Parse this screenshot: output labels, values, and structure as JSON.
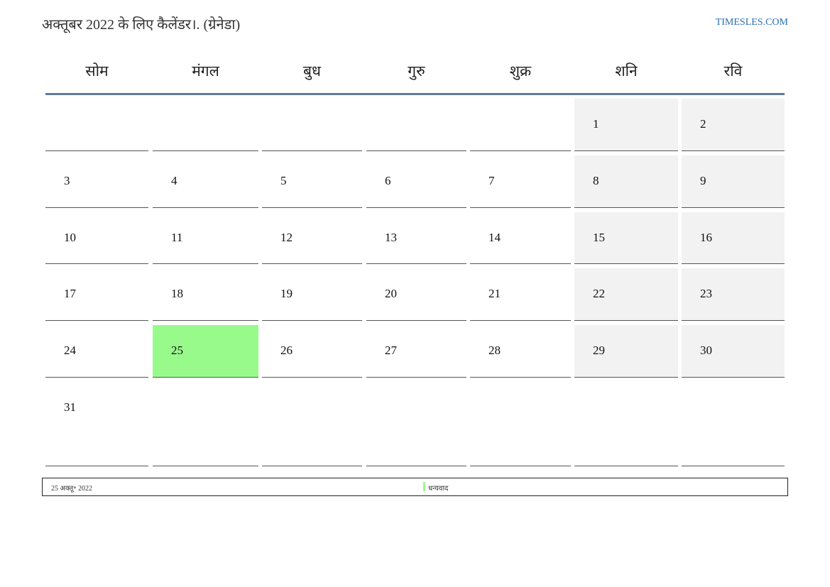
{
  "header": {
    "title": "अक्तूबर 2022 के लिए कैलेंडर।. (ग्रेनेडा)",
    "site_link": "TIMESLES.COM"
  },
  "weekdays": [
    "सोम",
    "मंगल",
    "बुध",
    "गुरु",
    "शुक्र",
    "शनि",
    "रवि"
  ],
  "weeks": [
    [
      "",
      "",
      "",
      "",
      "",
      "1",
      "2"
    ],
    [
      "3",
      "4",
      "5",
      "6",
      "7",
      "8",
      "9"
    ],
    [
      "10",
      "11",
      "12",
      "13",
      "14",
      "15",
      "16"
    ],
    [
      "17",
      "18",
      "19",
      "20",
      "21",
      "22",
      "23"
    ],
    [
      "24",
      "25",
      "26",
      "27",
      "28",
      "29",
      "30"
    ],
    [
      "31",
      "",
      "",
      "",
      "",
      "",
      ""
    ]
  ],
  "highlight": {
    "today": "25",
    "today_color": "#99fa8c",
    "weekend_color": "#f2f2f2"
  },
  "footer": {
    "date_text": "25 अक्तू॰ 2022",
    "thanks_text": "धन्यवाद"
  }
}
